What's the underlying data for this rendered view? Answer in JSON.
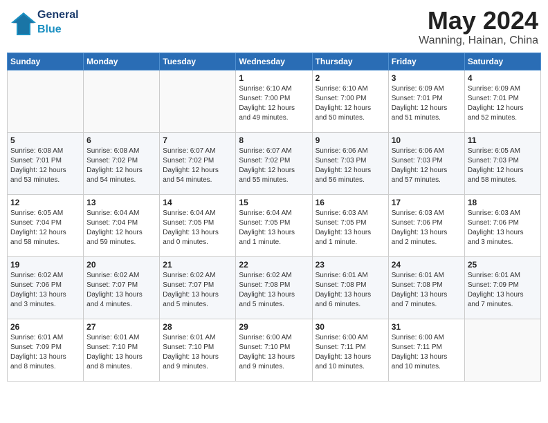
{
  "header": {
    "logo_general": "General",
    "logo_blue": "Blue",
    "month_year": "May 2024",
    "location": "Wanning, Hainan, China"
  },
  "weekdays": [
    "Sunday",
    "Monday",
    "Tuesday",
    "Wednesday",
    "Thursday",
    "Friday",
    "Saturday"
  ],
  "weeks": [
    [
      {
        "day": "",
        "info": ""
      },
      {
        "day": "",
        "info": ""
      },
      {
        "day": "",
        "info": ""
      },
      {
        "day": "1",
        "info": "Sunrise: 6:10 AM\nSunset: 7:00 PM\nDaylight: 12 hours\nand 49 minutes."
      },
      {
        "day": "2",
        "info": "Sunrise: 6:10 AM\nSunset: 7:00 PM\nDaylight: 12 hours\nand 50 minutes."
      },
      {
        "day": "3",
        "info": "Sunrise: 6:09 AM\nSunset: 7:01 PM\nDaylight: 12 hours\nand 51 minutes."
      },
      {
        "day": "4",
        "info": "Sunrise: 6:09 AM\nSunset: 7:01 PM\nDaylight: 12 hours\nand 52 minutes."
      }
    ],
    [
      {
        "day": "5",
        "info": "Sunrise: 6:08 AM\nSunset: 7:01 PM\nDaylight: 12 hours\nand 53 minutes."
      },
      {
        "day": "6",
        "info": "Sunrise: 6:08 AM\nSunset: 7:02 PM\nDaylight: 12 hours\nand 54 minutes."
      },
      {
        "day": "7",
        "info": "Sunrise: 6:07 AM\nSunset: 7:02 PM\nDaylight: 12 hours\nand 54 minutes."
      },
      {
        "day": "8",
        "info": "Sunrise: 6:07 AM\nSunset: 7:02 PM\nDaylight: 12 hours\nand 55 minutes."
      },
      {
        "day": "9",
        "info": "Sunrise: 6:06 AM\nSunset: 7:03 PM\nDaylight: 12 hours\nand 56 minutes."
      },
      {
        "day": "10",
        "info": "Sunrise: 6:06 AM\nSunset: 7:03 PM\nDaylight: 12 hours\nand 57 minutes."
      },
      {
        "day": "11",
        "info": "Sunrise: 6:05 AM\nSunset: 7:03 PM\nDaylight: 12 hours\nand 58 minutes."
      }
    ],
    [
      {
        "day": "12",
        "info": "Sunrise: 6:05 AM\nSunset: 7:04 PM\nDaylight: 12 hours\nand 58 minutes."
      },
      {
        "day": "13",
        "info": "Sunrise: 6:04 AM\nSunset: 7:04 PM\nDaylight: 12 hours\nand 59 minutes."
      },
      {
        "day": "14",
        "info": "Sunrise: 6:04 AM\nSunset: 7:05 PM\nDaylight: 13 hours\nand 0 minutes."
      },
      {
        "day": "15",
        "info": "Sunrise: 6:04 AM\nSunset: 7:05 PM\nDaylight: 13 hours\nand 1 minute."
      },
      {
        "day": "16",
        "info": "Sunrise: 6:03 AM\nSunset: 7:05 PM\nDaylight: 13 hours\nand 1 minute."
      },
      {
        "day": "17",
        "info": "Sunrise: 6:03 AM\nSunset: 7:06 PM\nDaylight: 13 hours\nand 2 minutes."
      },
      {
        "day": "18",
        "info": "Sunrise: 6:03 AM\nSunset: 7:06 PM\nDaylight: 13 hours\nand 3 minutes."
      }
    ],
    [
      {
        "day": "19",
        "info": "Sunrise: 6:02 AM\nSunset: 7:06 PM\nDaylight: 13 hours\nand 3 minutes."
      },
      {
        "day": "20",
        "info": "Sunrise: 6:02 AM\nSunset: 7:07 PM\nDaylight: 13 hours\nand 4 minutes."
      },
      {
        "day": "21",
        "info": "Sunrise: 6:02 AM\nSunset: 7:07 PM\nDaylight: 13 hours\nand 5 minutes."
      },
      {
        "day": "22",
        "info": "Sunrise: 6:02 AM\nSunset: 7:08 PM\nDaylight: 13 hours\nand 5 minutes."
      },
      {
        "day": "23",
        "info": "Sunrise: 6:01 AM\nSunset: 7:08 PM\nDaylight: 13 hours\nand 6 minutes."
      },
      {
        "day": "24",
        "info": "Sunrise: 6:01 AM\nSunset: 7:08 PM\nDaylight: 13 hours\nand 7 minutes."
      },
      {
        "day": "25",
        "info": "Sunrise: 6:01 AM\nSunset: 7:09 PM\nDaylight: 13 hours\nand 7 minutes."
      }
    ],
    [
      {
        "day": "26",
        "info": "Sunrise: 6:01 AM\nSunset: 7:09 PM\nDaylight: 13 hours\nand 8 minutes."
      },
      {
        "day": "27",
        "info": "Sunrise: 6:01 AM\nSunset: 7:10 PM\nDaylight: 13 hours\nand 8 minutes."
      },
      {
        "day": "28",
        "info": "Sunrise: 6:01 AM\nSunset: 7:10 PM\nDaylight: 13 hours\nand 9 minutes."
      },
      {
        "day": "29",
        "info": "Sunrise: 6:00 AM\nSunset: 7:10 PM\nDaylight: 13 hours\nand 9 minutes."
      },
      {
        "day": "30",
        "info": "Sunrise: 6:00 AM\nSunset: 7:11 PM\nDaylight: 13 hours\nand 10 minutes."
      },
      {
        "day": "31",
        "info": "Sunrise: 6:00 AM\nSunset: 7:11 PM\nDaylight: 13 hours\nand 10 minutes."
      },
      {
        "day": "",
        "info": ""
      }
    ]
  ]
}
